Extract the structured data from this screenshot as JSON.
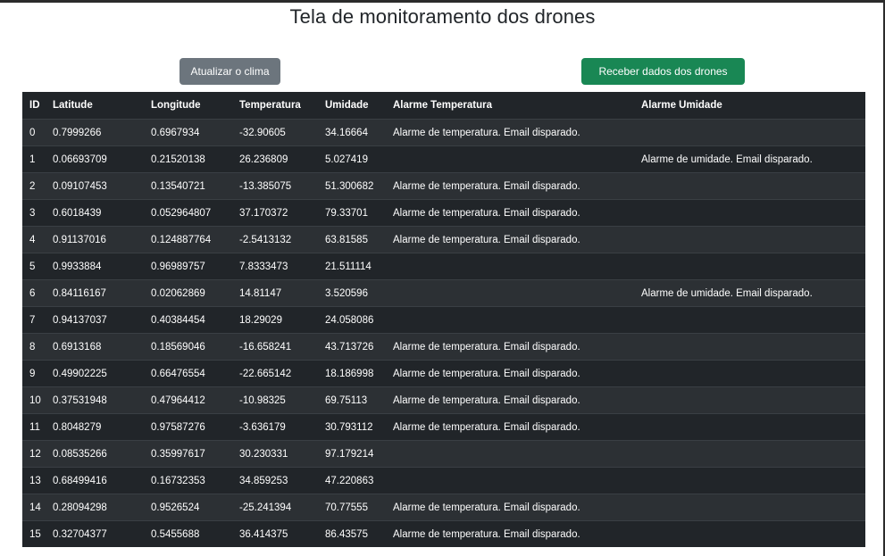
{
  "page": {
    "title": "Tela de monitoramento dos drones"
  },
  "toolbar": {
    "weather_button_label": "Atualizar o clima",
    "drones_button_label": "Receber dados dos drones"
  },
  "colors": {
    "weather_button": "#6c757d",
    "drones_button": "#198754",
    "table_dark": "#212529",
    "table_stripe": "#2c3034"
  },
  "table": {
    "headers": [
      "ID",
      "Latitude",
      "Longitude",
      "Temperatura",
      "Umidade",
      "Alarme Temperatura",
      "Alarme Umidade"
    ],
    "rows": [
      [
        "0",
        "0.7999266",
        "0.6967934",
        "-32.90605",
        "34.16664",
        "Alarme de temperatura. Email disparado.",
        ""
      ],
      [
        "1",
        "0.06693709",
        "0.21520138",
        "26.236809",
        "5.027419",
        "",
        "Alarme de umidade. Email disparado."
      ],
      [
        "2",
        "0.09107453",
        "0.13540721",
        "-13.385075",
        "51.300682",
        "Alarme de temperatura. Email disparado.",
        ""
      ],
      [
        "3",
        "0.6018439",
        "0.052964807",
        "37.170372",
        "79.33701",
        "Alarme de temperatura. Email disparado.",
        ""
      ],
      [
        "4",
        "0.91137016",
        "0.124887764",
        "-2.5413132",
        "63.81585",
        "Alarme de temperatura. Email disparado.",
        ""
      ],
      [
        "5",
        "0.9933884",
        "0.96989757",
        "7.8333473",
        "21.511114",
        "",
        ""
      ],
      [
        "6",
        "0.84116167",
        "0.02062869",
        "14.81147",
        "3.520596",
        "",
        "Alarme de umidade. Email disparado."
      ],
      [
        "7",
        "0.94137037",
        "0.40384454",
        "18.29029",
        "24.058086",
        "",
        ""
      ],
      [
        "8",
        "0.6913168",
        "0.18569046",
        "-16.658241",
        "43.713726",
        "Alarme de temperatura. Email disparado.",
        ""
      ],
      [
        "9",
        "0.49902225",
        "0.66476554",
        "-22.665142",
        "18.186998",
        "Alarme de temperatura. Email disparado.",
        ""
      ],
      [
        "10",
        "0.37531948",
        "0.47964412",
        "-10.98325",
        "69.75113",
        "Alarme de temperatura. Email disparado.",
        ""
      ],
      [
        "11",
        "0.8048279",
        "0.97587276",
        "-3.636179",
        "30.793112",
        "Alarme de temperatura. Email disparado.",
        ""
      ],
      [
        "12",
        "0.08535266",
        "0.35997617",
        "30.230331",
        "97.179214",
        "",
        ""
      ],
      [
        "13",
        "0.68499416",
        "0.16732353",
        "34.859253",
        "47.220863",
        "",
        ""
      ],
      [
        "14",
        "0.28094298",
        "0.9526524",
        "-25.241394",
        "70.77555",
        "Alarme de temperatura. Email disparado.",
        ""
      ],
      [
        "15",
        "0.32704377",
        "0.5455688",
        "36.414375",
        "86.43575",
        "Alarme de temperatura. Email disparado.",
        ""
      ]
    ]
  }
}
